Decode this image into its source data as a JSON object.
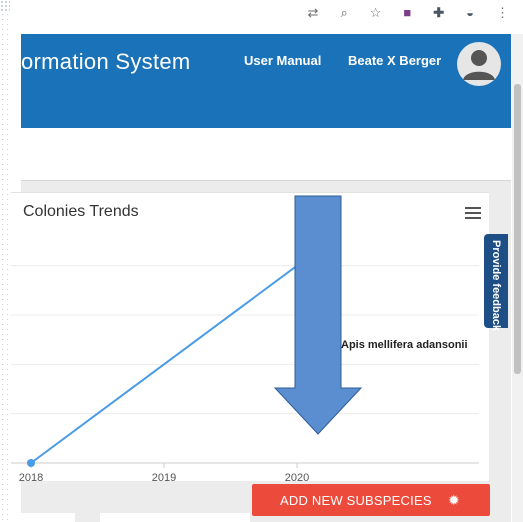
{
  "browser": {
    "icons": [
      {
        "name": "expand-icon",
        "glyph": "⇄"
      },
      {
        "name": "zoom-icon",
        "glyph": "⌕"
      },
      {
        "name": "star-icon",
        "glyph": "☆"
      },
      {
        "name": "extension-icon",
        "glyph": "■"
      },
      {
        "name": "puzzle-icon",
        "glyph": "✚"
      },
      {
        "name": "profile-icon",
        "glyph": "◒"
      },
      {
        "name": "more-icon",
        "glyph": "⋮"
      }
    ]
  },
  "header": {
    "title": "ormation System",
    "user_manual": "User Manual",
    "user_name": "Beate X Berger",
    "avatar_icon": "user-avatar-icon",
    "bg_color": "#1a73b8"
  },
  "card": {
    "title": "Colonies Trends",
    "menu_icon": "hamburger-menu-icon"
  },
  "chart_data": {
    "type": "line",
    "title": "Colonies Trends",
    "x": [
      2018,
      2020
    ],
    "tick_labels": [
      "2018",
      "2019",
      "2020"
    ],
    "series": [
      {
        "name": "Apis mellifera adansonii",
        "color": "#4a9be6",
        "points": [
          [
            2018,
            0
          ],
          [
            2020,
            4
          ]
        ]
      }
    ],
    "xlim": [
      2018,
      2021
    ],
    "ylim": [
      0,
      4.5
    ],
    "grid": true,
    "legend": "right",
    "annotation": "Apis mellifera adansonii"
  },
  "feedback": {
    "label": "Provide feedback"
  },
  "actions": {
    "add_subspecies": "ADD NEW SUBSPECIES",
    "add_icon": "bug-icon",
    "color": "#ec4b3c"
  },
  "overlay": {
    "arrow_icon": "down-arrow-icon",
    "color": "#5a8ed0"
  }
}
